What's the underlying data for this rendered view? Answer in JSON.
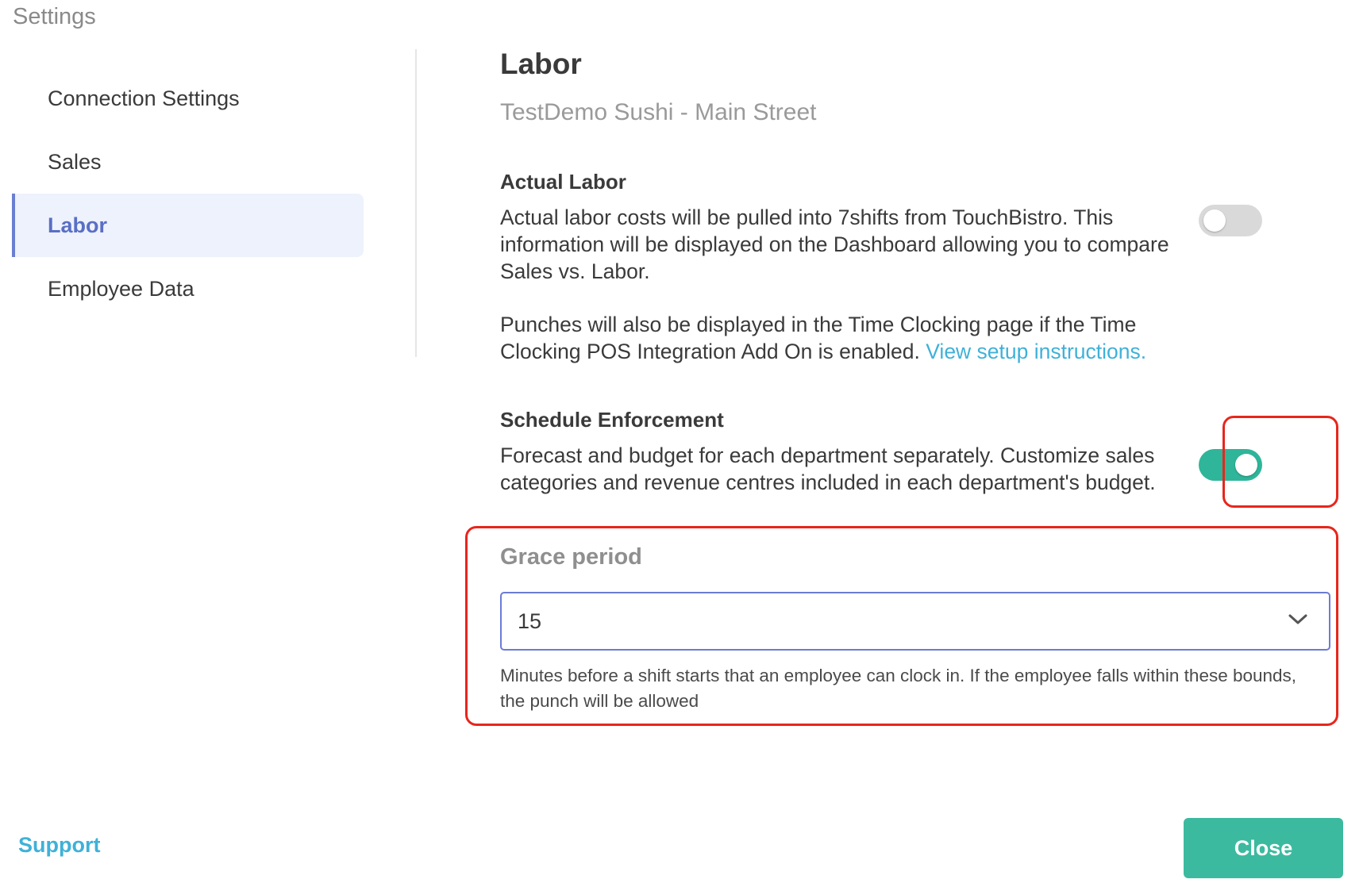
{
  "dialog": {
    "title": "Settings"
  },
  "sidebar": {
    "items": [
      {
        "label": "Connection Settings",
        "active": false
      },
      {
        "label": "Sales",
        "active": false
      },
      {
        "label": "Labor",
        "active": true
      },
      {
        "label": "Employee Data",
        "active": false
      }
    ]
  },
  "main": {
    "title": "Labor",
    "location": "TestDemo Sushi - Main Street",
    "actual_labor": {
      "heading": "Actual Labor",
      "description": "Actual labor costs will be pulled into 7shifts from TouchBistro. This information will be displayed on the Dashboard allowing you to compare Sales vs. Labor.",
      "punches_text": "Punches will also be displayed in the Time Clocking page if the Time Clocking POS Integration Add On is enabled.",
      "link_text": "View setup instructions.",
      "toggle_on": false
    },
    "schedule_enforcement": {
      "heading": "Schedule Enforcement",
      "description": "Forecast and budget for each department separately. Customize sales categories and revenue centres included in each department's budget.",
      "toggle_on": true
    },
    "grace_period": {
      "label": "Grace period",
      "value": "15",
      "help": "Minutes before a shift starts that an employee can clock in. If the employee falls within these bounds, the punch will be allowed"
    }
  },
  "footer": {
    "support_label": "Support",
    "close_label": "Close"
  },
  "colors": {
    "accent": "#3cba9f",
    "link": "#3fb1d8",
    "active_nav": "#5a6fc4",
    "highlight": "#e8261c"
  }
}
